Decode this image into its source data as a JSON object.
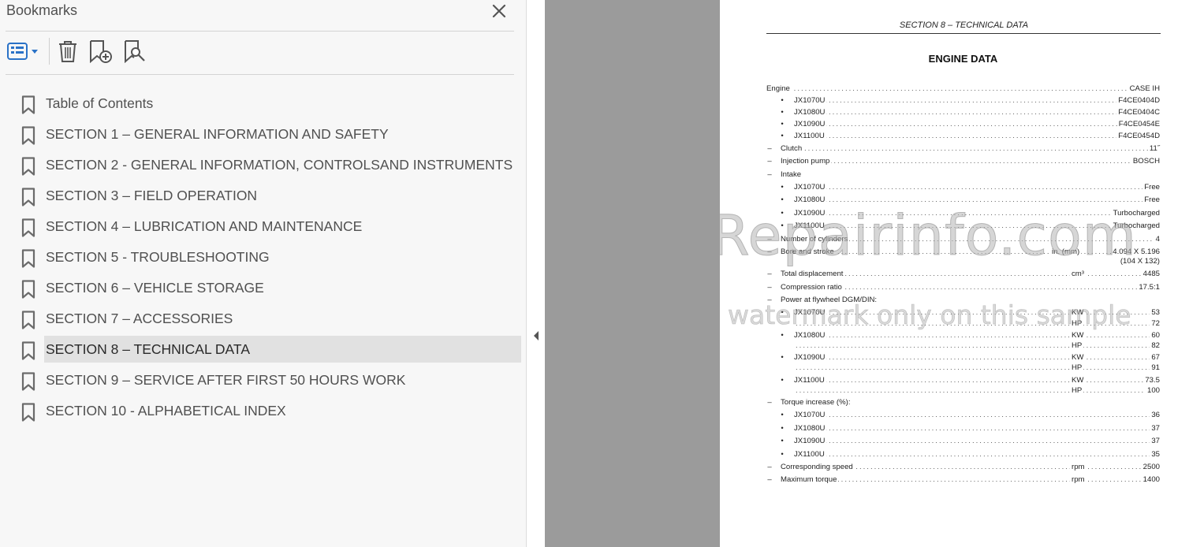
{
  "panel": {
    "title": "Bookmarks",
    "tools": [
      "options-menu",
      "delete-bookmark",
      "new-bookmark",
      "find-current-bookmark"
    ],
    "bookmarks": [
      {
        "label": "Table of Contents",
        "selected": false
      },
      {
        "label": "SECTION 1 – GENERAL INFORMATION AND SAFETY",
        "selected": false
      },
      {
        "label": "SECTION 2 - GENERAL INFORMATION, CONTROLSAND INSTRUMENTS",
        "selected": false
      },
      {
        "label": "SECTION 3 – FIELD OPERATION",
        "selected": false
      },
      {
        "label": "SECTION 4 – LUBRICATION AND MAINTENANCE",
        "selected": false
      },
      {
        "label": "SECTION 5 - TROUBLESHOOTING",
        "selected": false
      },
      {
        "label": "SECTION 6 – VEHICLE STORAGE",
        "selected": false
      },
      {
        "label": "SECTION 7 – ACCESSORIES",
        "selected": false
      },
      {
        "label": "SECTION 8 – TECHNICAL DATA",
        "selected": true
      },
      {
        "label": "SECTION 9 – SERVICE AFTER FIRST 50 HOURS WORK",
        "selected": false
      },
      {
        "label": "SECTION 10 - ALPHABETICAL INDEX",
        "selected": false
      }
    ]
  },
  "document": {
    "header": "SECTION 8 – TECHNICAL DATA",
    "title": "ENGINE DATA",
    "watermark_main": "eRepairinfo.com",
    "watermark_sub": "watermark only on this sample",
    "rows": [
      {
        "marker": "",
        "label": "Engine",
        "unit": "",
        "value": "CASE IH"
      },
      {
        "marker": "•",
        "label": "JX1070U",
        "unit": "",
        "value": "F4CE0404D"
      },
      {
        "marker": "•",
        "label": "JX1080U",
        "unit": "",
        "value": "F4CE0404C"
      },
      {
        "marker": "•",
        "label": "JX1090U",
        "unit": "",
        "value": "F4CE0454E"
      },
      {
        "marker": "•",
        "label": "JX1100U",
        "unit": "",
        "value": "F4CE0454D"
      },
      {
        "marker": "–",
        "label": "Clutch",
        "unit": "",
        "value": "11˝"
      },
      {
        "marker": "–",
        "label": "Injection pump",
        "unit": "",
        "value": "BOSCH"
      },
      {
        "marker": "–",
        "label": "Intake",
        "unit": "",
        "value": "",
        "nodots": true
      },
      {
        "marker": "•",
        "label": "JX1070U",
        "unit": "",
        "value": "Free"
      },
      {
        "marker": "•",
        "label": "JX1080U",
        "unit": "",
        "value": "Free"
      },
      {
        "marker": "•",
        "label": "JX1090U",
        "unit": "",
        "value": "Turbocharged"
      },
      {
        "marker": "•",
        "label": "JX1100U",
        "unit": "",
        "value": "Turbocharged"
      },
      {
        "marker": "–",
        "label": "Number of cylinders",
        "unit": "",
        "value": "4"
      },
      {
        "marker": "–",
        "label": "Bore and stroke",
        "unit": "in. (mm)",
        "value": "4.094 X 5.196"
      },
      {
        "marker": "",
        "label": "",
        "unit": "",
        "value": "(104 X 132)",
        "nodots": true
      },
      {
        "marker": "–",
        "label": "Total displacement",
        "unit": "cm³",
        "value": "4485"
      },
      {
        "marker": "–",
        "label": "Compression ratio",
        "unit": "",
        "value": "17.5:1"
      },
      {
        "marker": "–",
        "label": "Power at flywheel DGM/DIN:",
        "unit": "",
        "value": "",
        "nodots": true
      },
      {
        "marker": "•",
        "label": "JX1070U",
        "unit": "KW",
        "value": "53"
      },
      {
        "marker": "",
        "label": "",
        "unit": "HP",
        "value": "72"
      },
      {
        "marker": "•",
        "label": "JX1080U",
        "unit": "KW",
        "value": "60"
      },
      {
        "marker": "",
        "label": "",
        "unit": "HP",
        "value": "82"
      },
      {
        "marker": "•",
        "label": "JX1090U",
        "unit": "KW",
        "value": "67"
      },
      {
        "marker": "",
        "label": "",
        "unit": "HP",
        "value": "91"
      },
      {
        "marker": "•",
        "label": "JX1100U",
        "unit": "KW",
        "value": "73.5"
      },
      {
        "marker": "",
        "label": "",
        "unit": "HP",
        "value": "100"
      },
      {
        "marker": "–",
        "label": "Torque increase (%):",
        "unit": "",
        "value": "",
        "nodots": true
      },
      {
        "marker": "•",
        "label": "JX1070U",
        "unit": "",
        "value": "36"
      },
      {
        "marker": "•",
        "label": "JX1080U",
        "unit": "",
        "value": "37"
      },
      {
        "marker": "•",
        "label": "JX1090U",
        "unit": "",
        "value": "37"
      },
      {
        "marker": "•",
        "label": "JX1100U",
        "unit": "",
        "value": "35"
      },
      {
        "marker": "–",
        "label": "Corresponding speed",
        "unit": "rpm",
        "value": "2500"
      },
      {
        "marker": "–",
        "label": "Maximum torque",
        "unit": "rpm",
        "value": "1400"
      }
    ]
  }
}
